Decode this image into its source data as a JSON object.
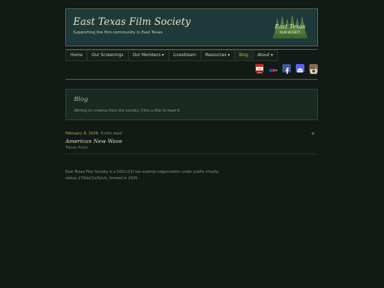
{
  "site": {
    "title": "East Texas Film Society",
    "tagline": "Supporting the film community in East Texas",
    "logo_line1": "East Texas",
    "logo_line2": "FILM SOCIETY"
  },
  "nav": {
    "items": [
      {
        "label": "Home"
      },
      {
        "label": "Our Screenings"
      },
      {
        "label": "Our Members ▾"
      },
      {
        "label": "Livestream"
      },
      {
        "label": "Resources ▾"
      },
      {
        "label": "Blog"
      },
      {
        "label": "About ▾"
      }
    ],
    "active_index": 5
  },
  "social": [
    "youtube-icon",
    "flickr-icon",
    "facebook-icon",
    "discord-icon",
    "instagram-icon"
  ],
  "blog": {
    "title": "Blog",
    "description": "Writing on cinema from the society. Click a title to read it."
  },
  "post": {
    "date": "February 6, 2026",
    "read_time": "6 min read",
    "expand": "+",
    "title": "American New Wave",
    "author": "Trevor Hicks"
  },
  "footer": {
    "text": "East Texas Film Society is a 501(c)(3) tax exempt organization under public charity status 170(b)(1)(A)(vi), formed in 2025."
  },
  "colors": {
    "background": "#111a15",
    "accent": "#d6a85a",
    "header_bg": "#1f3a3a"
  }
}
